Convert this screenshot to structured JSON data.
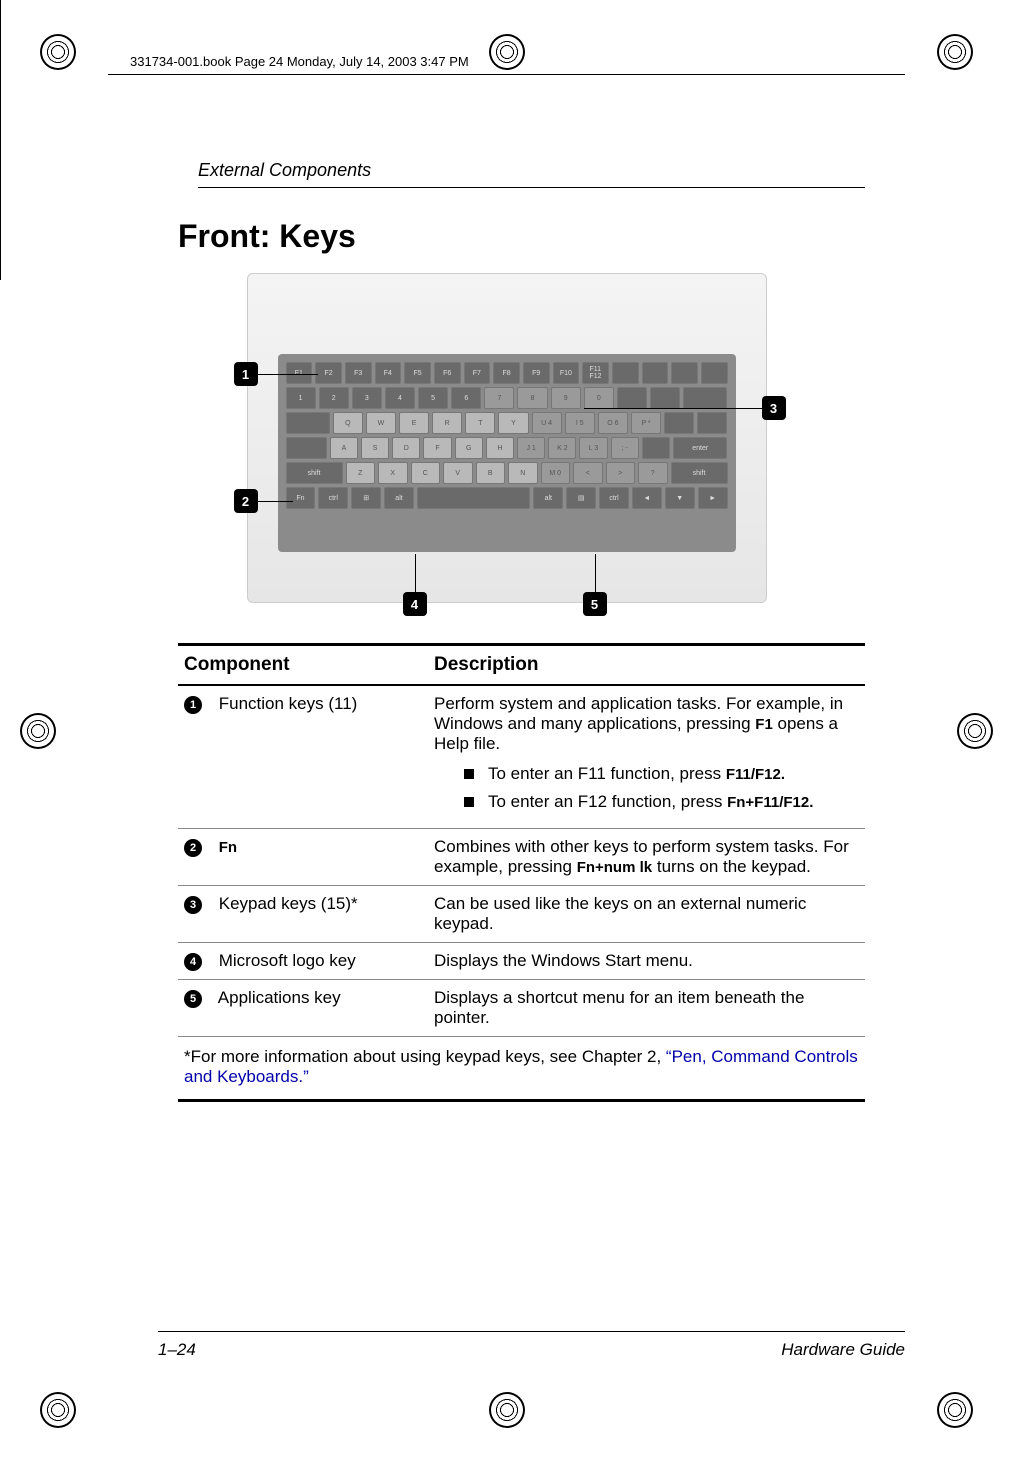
{
  "meta": {
    "header_line": "331734-001.book  Page 24  Monday, July 14, 2003  3:47 PM"
  },
  "section": "External Components",
  "heading": "Front: Keys",
  "figure": {
    "callouts": [
      "1",
      "2",
      "3",
      "4",
      "5"
    ]
  },
  "table": {
    "headers": {
      "component": "Component",
      "description": "Description"
    },
    "rows": [
      {
        "num": "1",
        "component": "Function keys (11)",
        "description_intro": "Perform system and application tasks. For example, in Windows and many applications, pressing ",
        "description_kbd1": "F1",
        "description_outro": " opens a Help file.",
        "bullets": [
          {
            "pre": "To enter an F11 function, press ",
            "kbd": "F11/F12."
          },
          {
            "pre": "To enter an F12 function, press ",
            "kbd": "Fn+F11/F12."
          }
        ]
      },
      {
        "num": "2",
        "component": "Fn",
        "component_bold": true,
        "description_intro": "Combines with other keys to perform system tasks. For example, pressing ",
        "description_kbd1": "Fn+num lk",
        "description_outro": " turns on the keypad."
      },
      {
        "num": "3",
        "component": "Keypad keys (15)*",
        "description_intro": "Can be used like the keys on an external numeric keypad.",
        "description_kbd1": "",
        "description_outro": ""
      },
      {
        "num": "4",
        "component": "Microsoft logo key",
        "description_intro": "Displays the Windows Start menu.",
        "description_kbd1": "",
        "description_outro": ""
      },
      {
        "num": "5",
        "component": "Applications key",
        "description_intro": "Displays a shortcut menu for an item beneath the pointer.",
        "description_kbd1": "",
        "description_outro": ""
      }
    ],
    "footnote_pre": "*For more information about using keypad keys, see Chapter 2, ",
    "footnote_link": "“Pen, Command Controls and Keyboards.”"
  },
  "footer": {
    "page": "1–24",
    "doc": "Hardware Guide"
  }
}
